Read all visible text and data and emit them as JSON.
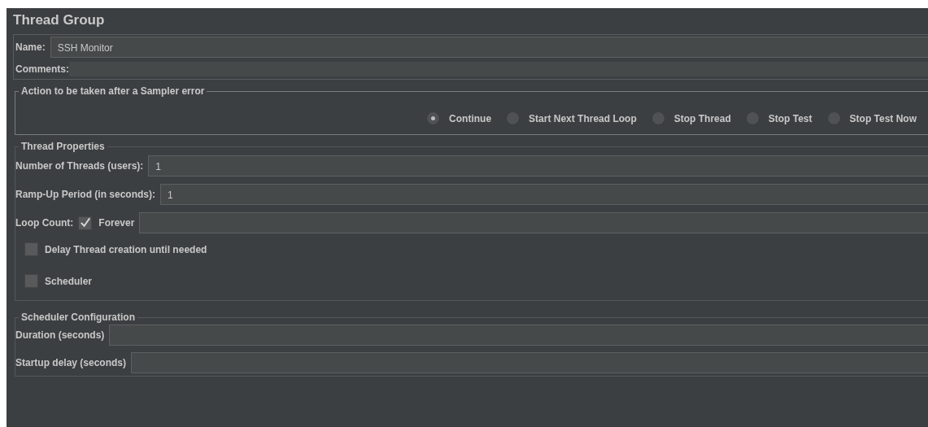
{
  "title": "Thread Group",
  "name": {
    "label": "Name:",
    "value": "SSH Monitor"
  },
  "comments": {
    "label": "Comments:"
  },
  "sampler_error": {
    "legend": "Action to be taken after a Sampler error",
    "options": [
      {
        "label": "Continue",
        "selected": true
      },
      {
        "label": "Start Next Thread Loop",
        "selected": false
      },
      {
        "label": "Stop Thread",
        "selected": false
      },
      {
        "label": "Stop Test",
        "selected": false
      },
      {
        "label": "Stop Test Now",
        "selected": false
      }
    ]
  },
  "thread_properties": {
    "legend": "Thread Properties",
    "threads": {
      "label": "Number of Threads (users):",
      "value": "1"
    },
    "ramp_up": {
      "label": "Ramp-Up Period (in seconds):",
      "value": "1"
    },
    "loop_count": {
      "label": "Loop Count:",
      "forever_label": "Forever",
      "forever_checked": true
    },
    "delay_creation": {
      "label": "Delay Thread creation until needed",
      "checked": false
    },
    "scheduler": {
      "label": "Scheduler",
      "checked": false
    }
  },
  "scheduler_configuration": {
    "legend": "Scheduler Configuration",
    "duration": {
      "label": "Duration (seconds)"
    },
    "startup_delay": {
      "label": "Startup delay (seconds)"
    }
  }
}
